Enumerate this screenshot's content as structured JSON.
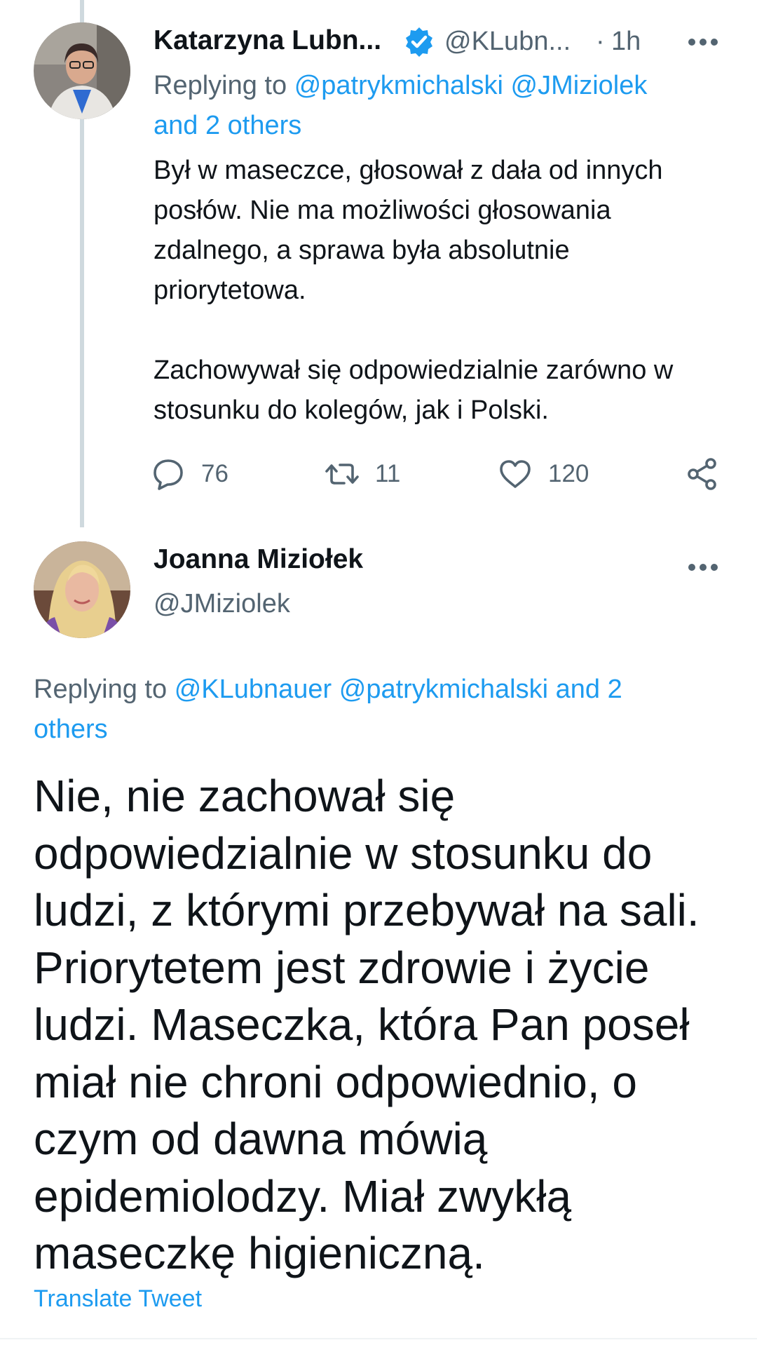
{
  "tweet1": {
    "author_name": "Katarzyna Lubn...",
    "handle": "@KLubn...",
    "separator": "·",
    "time": "1h",
    "replying_prefix": "Replying to",
    "replying_mentions_line1": "@patrykmichalski @JMiziolek",
    "replying_mentions_line2": "and 2 others",
    "text": "Był w maseczce, głosował z dała od innych posłów. Nie ma możliwości głosowania zdalnego, a sprawa była absolutnie priorytetowa.\n\nZachowywał się odpowiedzialnie zarówno w stosunku do kolegów, jak i Polski.",
    "reply_count": "76",
    "retweet_count": "11",
    "like_count": "120",
    "verified_color": "#1d9bf0"
  },
  "tweet2": {
    "author_name": "Joanna Miziołek",
    "handle": "@JMiziolek",
    "replying_prefix": "Replying to",
    "replying_mentions_line1": "@KLubnauer @patrykmichalski and 2",
    "replying_mentions_line2": "others",
    "text": "Nie, nie zachował się odpowiedzialnie w stosunku do ludzi, z którymi przebywał na sali. Priorytetem jest zdrowie i życie ludzi. Maseczka, która Pan poseł miał nie chroni odpowiednio, o czym od dawna mówią epidemiolodzy. Miał zwykłą maseczkę higieniczną.",
    "translate_label": "Translate Tweet"
  },
  "colors": {
    "accent": "#1d9bf0",
    "text": "#0f1419",
    "muted": "#536471",
    "thread_line": "#cfd9de"
  },
  "icons": {
    "reply": "speech-bubble-icon",
    "retweet": "retweet-arrows-icon",
    "like": "heart-outline-icon",
    "share": "share-nodes-icon",
    "more": "three-dots-icon",
    "verified": "verified-badge-icon"
  }
}
